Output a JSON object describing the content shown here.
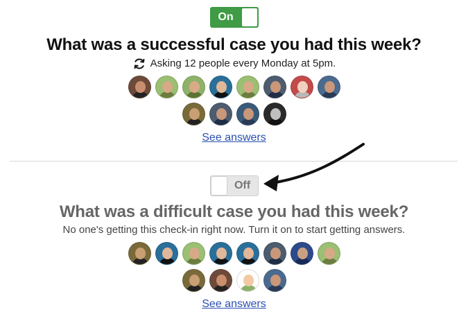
{
  "checkins": [
    {
      "toggle_label": "On",
      "state": "on",
      "question": "What was a successful case you had this week?",
      "schedule_icon": "refresh-icon",
      "schedule_text": "Asking 12 people every Monday at 5pm.",
      "avatars": [
        {
          "bg": "#6e4a3a",
          "face": "#c98e6e",
          "body": "#222"
        },
        {
          "bg": "#9bbf73",
          "face": "#d8a987",
          "body": "#6c7d3f"
        },
        {
          "bg": "#8fb26a",
          "face": "#d9aa88",
          "body": "#5d7233"
        },
        {
          "bg": "#2a6f9a",
          "face": "#e0b798",
          "body": "#111"
        },
        {
          "bg": "#9bbf73",
          "face": "#d8a987",
          "body": "#6c7d3f"
        },
        {
          "bg": "#4d5c6e",
          "face": "#c9977a",
          "body": "#1f2d47"
        },
        {
          "bg": "#c44a4a",
          "face": "#f0d0c0",
          "body": "#b8b8b8"
        },
        {
          "bg": "#4a6a8f",
          "face": "#c9977a",
          "body": "#2a3a55"
        },
        {
          "bg": "#7a6a3a",
          "face": "#c99f74",
          "body": "#222"
        },
        {
          "bg": "#4d5c6e",
          "face": "#c9977a",
          "body": "#1f2d47"
        },
        {
          "bg": "#3a5a7a",
          "face": "#c9977a",
          "body": "#2a3a55"
        },
        {
          "bg": "#2a2a2a",
          "face": "#bfbfbf",
          "body": "#111"
        }
      ],
      "answers_link": "See answers"
    },
    {
      "toggle_label": "Off",
      "state": "off",
      "question": "What was a difficult case you had this week?",
      "schedule_text": "No one's getting this check-in right now. Turn it on to start getting answers.",
      "avatars": [
        {
          "bg": "#7a6a3a",
          "face": "#c99f74",
          "body": "#222"
        },
        {
          "bg": "#2a6f9a",
          "face": "#e0b798",
          "body": "#111"
        },
        {
          "bg": "#9bbf73",
          "face": "#d8a987",
          "body": "#6c7d3f"
        },
        {
          "bg": "#2a6f9a",
          "face": "#e0b798",
          "body": "#111"
        },
        {
          "bg": "#2a6f9a",
          "face": "#e0b798",
          "body": "#111"
        },
        {
          "bg": "#4d5c6e",
          "face": "#c9977a",
          "body": "#1f2d47"
        },
        {
          "bg": "#2d4a8a",
          "face": "#c9a182",
          "body": "#1a2a55"
        },
        {
          "bg": "#9bbf73",
          "face": "#d8a987",
          "body": "#6c7d3f"
        },
        {
          "bg": "#7a6a3a",
          "face": "#c99f74",
          "body": "#222"
        },
        {
          "bg": "#6e4a3a",
          "face": "#c98e6e",
          "body": "#222"
        },
        {
          "bg": "#ffffff",
          "face": "#f2c9a4",
          "body": "#8ab06a"
        },
        {
          "bg": "#4a6a8f",
          "face": "#c9977a",
          "body": "#2a3a55"
        }
      ],
      "answers_link": "See answers"
    }
  ],
  "colors": {
    "on_green": "#3f9b45",
    "link_blue": "#2a4fb0"
  }
}
